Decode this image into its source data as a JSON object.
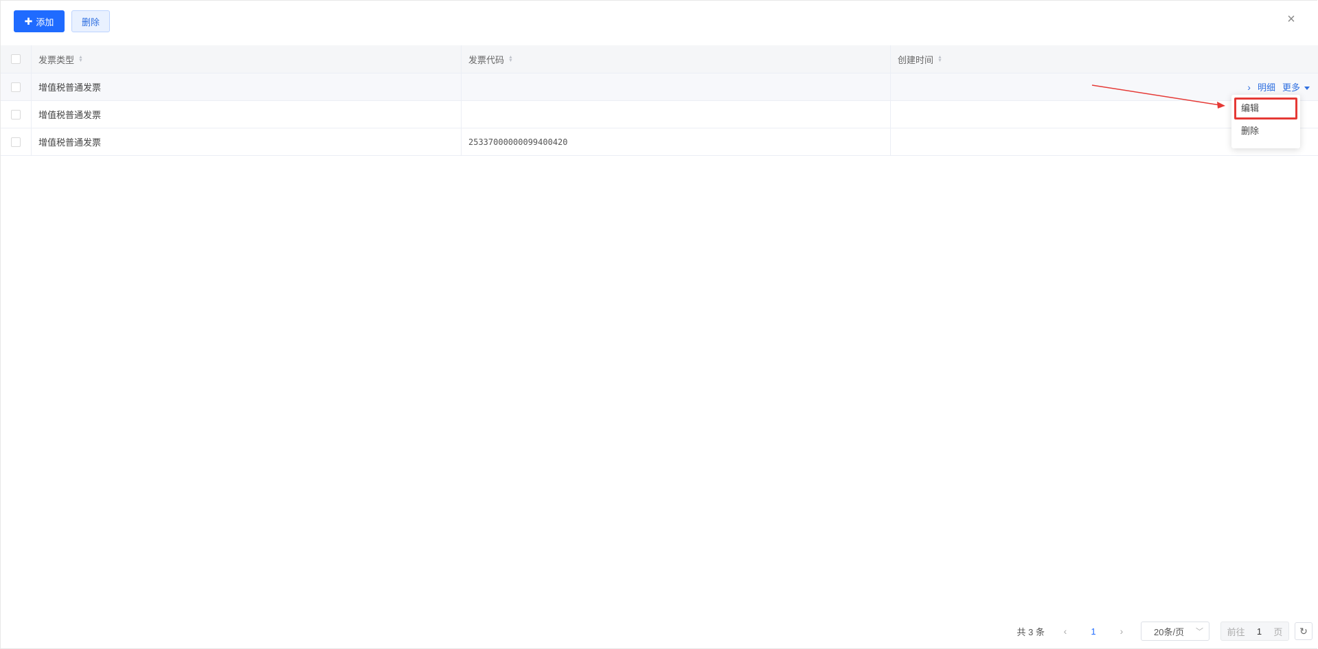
{
  "toolbar": {
    "add_label": "添加",
    "add_icon": "plus-icon",
    "delete_label": "删除"
  },
  "close_icon": "close-icon",
  "table": {
    "columns": [
      "发票类型",
      "发票代码",
      "创建时间"
    ],
    "rows": [
      {
        "type": "增值税普通发票",
        "code": "",
        "time": ""
      },
      {
        "type": "增值税普通发票",
        "code": "",
        "time": ""
      },
      {
        "type": "增值税普通发票",
        "code": "25337000000099400420",
        "time": ""
      }
    ],
    "row_actions": {
      "detail": "明细",
      "more": "更多"
    }
  },
  "dropdown": {
    "items": [
      "编辑",
      "删除"
    ]
  },
  "annotation": {
    "color": "#e53935"
  },
  "pagination": {
    "total": "共 3 条",
    "current_page": "1",
    "page_size": "20条/页",
    "goto_prefix": "前往",
    "goto_value": "1",
    "goto_suffix": "页"
  },
  "colors": {
    "primary": "#1f6bff",
    "link": "#2f6fe0"
  }
}
